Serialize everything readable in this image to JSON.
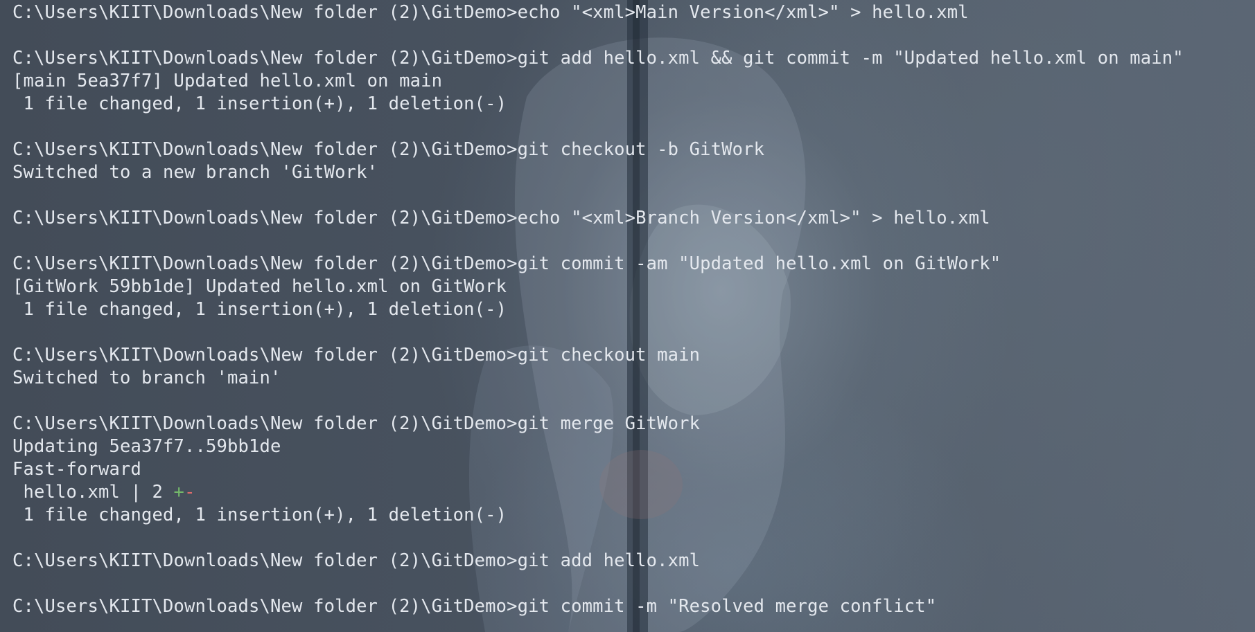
{
  "terminal": {
    "lines": [
      "C:\\Users\\KIIT\\Downloads\\New folder (2)\\GitDemo>echo \"<xml>Main Version</xml>\" > hello.xml",
      "",
      "C:\\Users\\KIIT\\Downloads\\New folder (2)\\GitDemo>git add hello.xml && git commit -m \"Updated hello.xml on main\"",
      "[main 5ea37f7] Updated hello.xml on main",
      " 1 file changed, 1 insertion(+), 1 deletion(-)",
      "",
      "C:\\Users\\KIIT\\Downloads\\New folder (2)\\GitDemo>git checkout -b GitWork",
      "Switched to a new branch 'GitWork'",
      "",
      "C:\\Users\\KIIT\\Downloads\\New folder (2)\\GitDemo>echo \"<xml>Branch Version</xml>\" > hello.xml",
      "",
      "C:\\Users\\KIIT\\Downloads\\New folder (2)\\GitDemo>git commit -am \"Updated hello.xml on GitWork\"",
      "[GitWork 59bb1de] Updated hello.xml on GitWork",
      " 1 file changed, 1 insertion(+), 1 deletion(-)",
      "",
      "C:\\Users\\KIIT\\Downloads\\New folder (2)\\GitDemo>git checkout main",
      "Switched to branch 'main'",
      "",
      "C:\\Users\\KIIT\\Downloads\\New folder (2)\\GitDemo>git merge GitWork",
      "Updating 5ea37f7..59bb1de",
      "Fast-forward"
    ],
    "diffstat": {
      "prefix": " hello.xml | 2 ",
      "plus": "+",
      "minus": "-"
    },
    "lines_after": [
      " 1 file changed, 1 insertion(+), 1 deletion(-)",
      "",
      "C:\\Users\\KIIT\\Downloads\\New folder (2)\\GitDemo>git add hello.xml",
      "",
      "C:\\Users\\KIIT\\Downloads\\New folder (2)\\GitDemo>git commit -m \"Resolved merge conflict\""
    ]
  },
  "colors": {
    "text": "#e4e8ee",
    "diff_plus": "#74b86a",
    "diff_minus": "#e06c6c",
    "background": "#4a5461"
  }
}
